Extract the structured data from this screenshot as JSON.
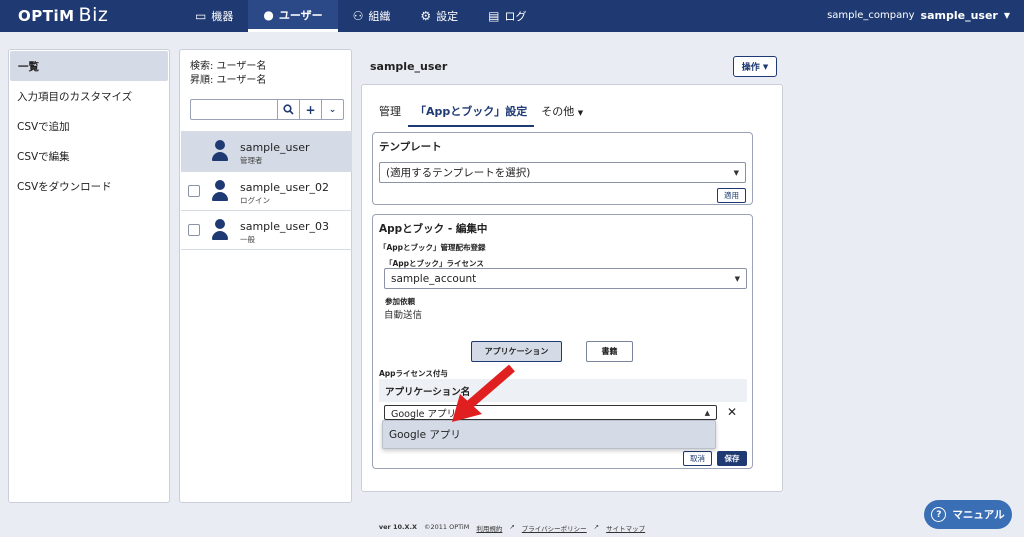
{
  "header": {
    "logo_text": "OPTiM",
    "logo_biz": "Biz",
    "nav": [
      {
        "label": "機器",
        "icon": "device-icon"
      },
      {
        "label": "ユーザー",
        "icon": "user-icon"
      },
      {
        "label": "組織",
        "icon": "organization-icon"
      },
      {
        "label": "設定",
        "icon": "gear-icon"
      },
      {
        "label": "ログ",
        "icon": "log-icon"
      }
    ],
    "active_nav": "ユーザー",
    "company": "sample_company",
    "user": "sample_user"
  },
  "sidebar": {
    "items": [
      "一覧",
      "入力項目のカスタマイズ",
      "CSVで追加",
      "CSVで編集",
      "CSVをダウンロード"
    ]
  },
  "user_list": {
    "search_label": "検索: ユーザー名",
    "sort_label": "昇順: ユーザー名",
    "search_placeholder": "",
    "users": [
      {
        "name": "sample_user",
        "role": "管理者"
      },
      {
        "name": "sample_user_02",
        "role": "ログイン"
      },
      {
        "name": "sample_user_03",
        "role": "一般"
      }
    ]
  },
  "detail": {
    "title": "sample_user",
    "ops_label": "操作",
    "tabs": [
      "管理",
      "「Appとブック」設定",
      "その他"
    ],
    "template": {
      "title": "テンプレート",
      "select_placeholder": "(適用するテンプレートを選択)",
      "apply_label": "適用"
    },
    "edit": {
      "title": "Appとブック - 編集中",
      "dist_label": "「Appとブック」管理配布登録",
      "license_label": "「Appとブック」ライセンス",
      "license_value": "sample_account",
      "participation_label": "参加依頼",
      "participation_value": "自動送信",
      "btn_app": "アプリケーション",
      "btn_book": "書籍",
      "license_assign_label": "Appライセンス付与",
      "col_app_name": "アプリケーション名",
      "app_select_value": "Google アプリ",
      "cancel_label": "取消",
      "save_label": "保存"
    },
    "dropdown_option": "Google アプリ"
  },
  "footer": {
    "version": "ver 10.X.X",
    "copyright": "©2011 OPTiM",
    "links": [
      "利用規約",
      "プライバシーポリシー",
      "サイトマップ"
    ]
  },
  "manual_label": "マニュアル",
  "colors": {
    "brand": "#1f3a73",
    "annotation_arrow": "#e02020"
  }
}
